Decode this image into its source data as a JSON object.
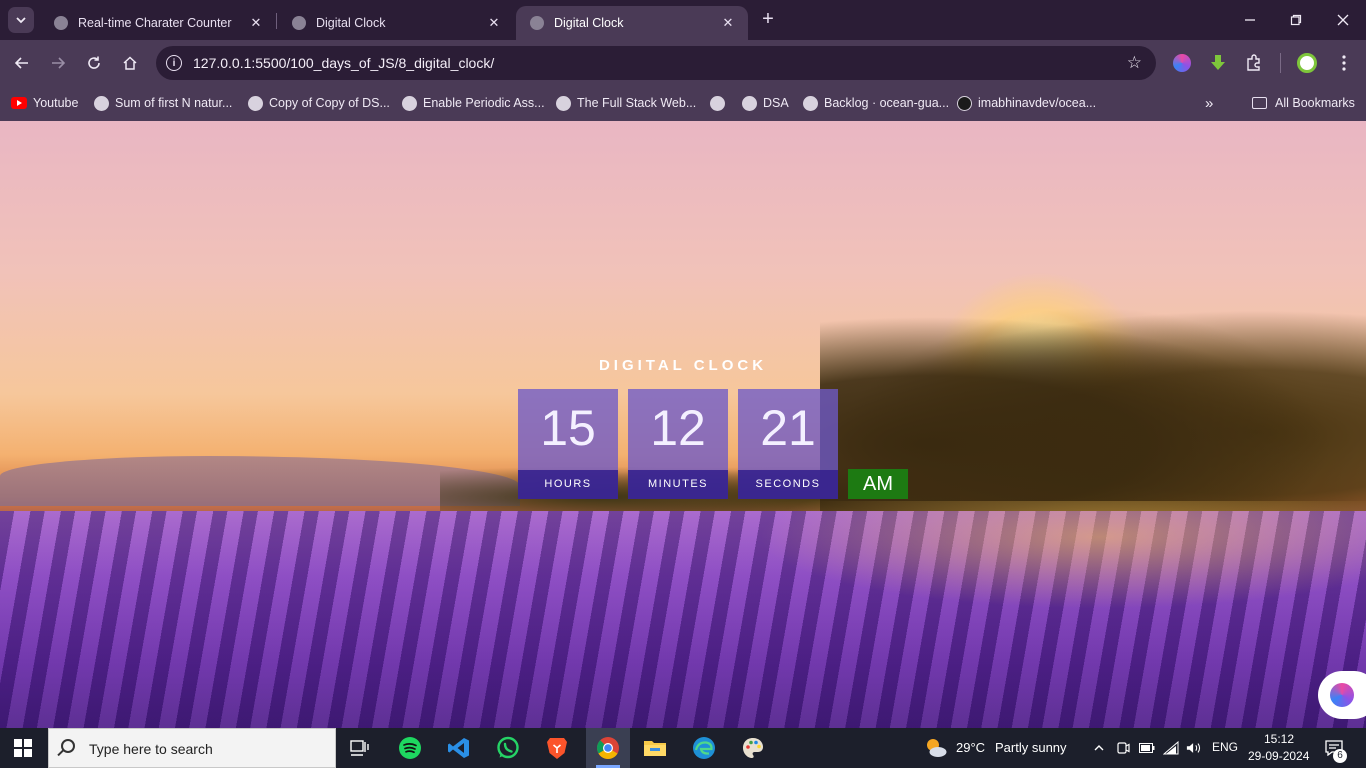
{
  "browser": {
    "tabs": [
      {
        "label": "Real-time Charater Counter",
        "active": false
      },
      {
        "label": "Digital Clock",
        "active": false
      },
      {
        "label": "Digital Clock",
        "active": true
      }
    ],
    "url": "127.0.0.1:5500/100_days_of_JS/8_digital_clock/",
    "bookmarks": [
      {
        "label": "Youtube"
      },
      {
        "label": "Sum of first N natur..."
      },
      {
        "label": "Copy of Copy of DS..."
      },
      {
        "label": "Enable Periodic Ass..."
      },
      {
        "label": "The Full Stack Web..."
      },
      {
        "label": ""
      },
      {
        "label": "DSA"
      },
      {
        "label": "Backlog · ocean-gua..."
      },
      {
        "label": "imabhinavdev/ocea..."
      }
    ],
    "all_bookmarks_label": "All Bookmarks"
  },
  "clock": {
    "title": "DIGITAL CLOCK",
    "hours": "15",
    "hours_label": "HOURS",
    "minutes": "12",
    "minutes_label": "MINUTES",
    "seconds": "21",
    "seconds_label": "SECONDS",
    "period": "AM"
  },
  "taskbar": {
    "search_placeholder": "Type here to search",
    "weather_temp": "29°C",
    "weather_desc": "Partly sunny",
    "language": "ENG",
    "time": "15:12",
    "date": "29-09-2024",
    "notification_count": "6"
  },
  "colors": {
    "chrome_bg": "#4a3a56",
    "tab_strip_bg": "#2b1d36",
    "clock_box": "#6e5ac8",
    "clock_label_bar": "#321e8c",
    "ampm_bg": "#1d7a12",
    "taskbar_bg": "#1c1f2b"
  }
}
